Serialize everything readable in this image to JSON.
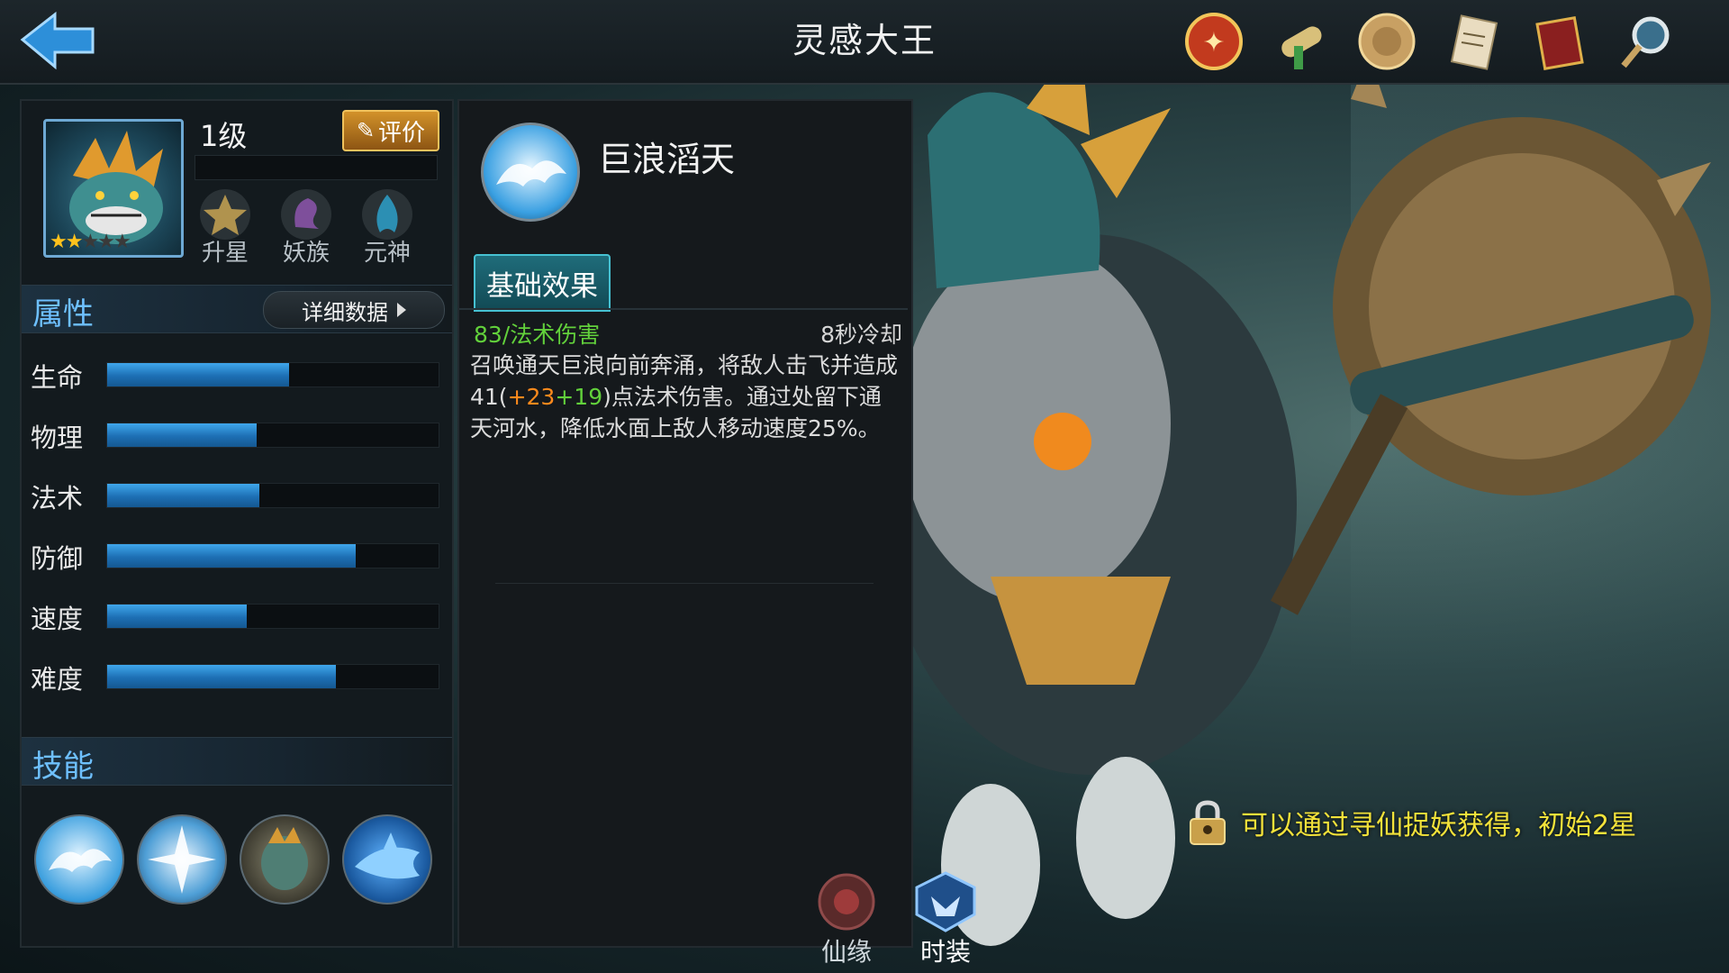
{
  "header": {
    "title": "灵感大王",
    "icons": [
      "trial-seal-icon",
      "scroll-icon",
      "coin-icon",
      "document-icon",
      "book-icon",
      "magnifier-icon"
    ]
  },
  "hero": {
    "level": "1级",
    "stars_filled": 2,
    "stars_total": 5,
    "rate_label": "评价",
    "buttons": [
      {
        "label": "升星",
        "icon": "star-upgrade-icon"
      },
      {
        "label": "妖族",
        "icon": "demon-clan-icon"
      },
      {
        "label": "元神",
        "icon": "spirit-icon"
      }
    ]
  },
  "attributes": {
    "title": "属性",
    "detail_button": "详细数据",
    "stats": [
      {
        "label": "生命",
        "value": 0.55
      },
      {
        "label": "物理",
        "value": 0.45
      },
      {
        "label": "法术",
        "value": 0.46
      },
      {
        "label": "防御",
        "value": 0.75
      },
      {
        "label": "速度",
        "value": 0.42
      },
      {
        "label": "难度",
        "value": 0.69
      }
    ]
  },
  "skills": {
    "title": "技能",
    "icons": [
      "wave-skill-icon",
      "ice-shard-skill-icon",
      "fish-warrior-skill-icon",
      "shark-skill-icon"
    ]
  },
  "skill_detail": {
    "name": "巨浪滔天",
    "tab": "基础效果",
    "damage": "83/法术伤害",
    "cooldown": "8秒冷却",
    "desc_part1": "召唤通天巨浪向前奔涌，将敌人击飞并造成41(",
    "desc_bonus1": "+23",
    "desc_bonus2": "+19",
    "desc_part2": ")点法术伤害。通过处留下通天河水，降低水面上敌人移动速度25%。"
  },
  "hint": "可以通过寻仙捉妖获得，初始2星",
  "bottom_tabs": [
    {
      "label": "仙缘",
      "icon": "fate-icon"
    },
    {
      "label": "时装",
      "icon": "costume-icon"
    }
  ],
  "colors": {
    "accent_blue": "#6ec0ff",
    "stat_fill": "#2a88d0",
    "hint_yellow": "#f3e23a",
    "damage_green": "#62d13b",
    "bonus_orange": "#ff8a1c"
  }
}
